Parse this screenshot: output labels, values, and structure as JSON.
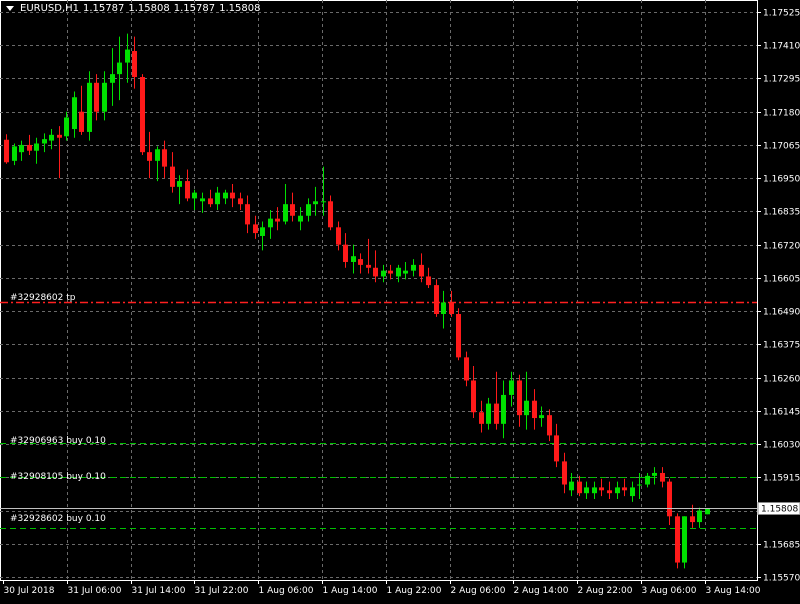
{
  "header": {
    "symbol": "EURUSD,H1",
    "open": "1.15787",
    "high": "1.15808",
    "low": "1.15787",
    "close": "1.15808"
  },
  "orders": [
    {
      "label": "#32906963 buy 0.10",
      "price": 1.16035,
      "color": "#00c000"
    },
    {
      "label": "#32908105 buy 0.10",
      "price": 1.15915,
      "color": "#00c000"
    },
    {
      "label": "#32928602 buy 0.10",
      "price": 1.1574,
      "color": "#00c000"
    }
  ],
  "tp_line": {
    "label": "#32928602 tp",
    "price": 1.1652,
    "color": "#ff2020"
  },
  "current_price": {
    "label": "1.15808",
    "price": 1.15808
  },
  "colors": {
    "bull": "#00e000",
    "bear": "#ff1a1a",
    "grid": "#6a6a6a",
    "background": "#000000"
  },
  "chart_data": {
    "type": "candlestick",
    "ylim": [
      1.1557,
      1.17525
    ],
    "y_ticks": [
      "1.17525",
      "1.17410",
      "1.17295",
      "1.17180",
      "1.17065",
      "1.16950",
      "1.16835",
      "1.16720",
      "1.16605",
      "1.16490",
      "1.16375",
      "1.16260",
      "1.16145",
      "1.16030",
      "1.15915",
      "1.15800",
      "1.15685",
      "1.15570"
    ],
    "x_ticks": [
      "30 Jul 2018",
      "31 Jul 06:00",
      "31 Jul 14:00",
      "31 Jul 22:00",
      "1 Aug 06:00",
      "1 Aug 14:00",
      "1 Aug 22:00",
      "2 Aug 06:00",
      "2 Aug 14:00",
      "2 Aug 22:00",
      "3 Aug 06:00",
      "3 Aug 14:00"
    ],
    "candles": [
      [
        1.17083,
        1.17102,
        1.17,
        1.17005
      ],
      [
        1.1701,
        1.1707,
        1.16995,
        1.1706
      ],
      [
        1.1704,
        1.1708,
        1.1701,
        1.17065
      ],
      [
        1.17065,
        1.171,
        1.1703,
        1.17045
      ],
      [
        1.17045,
        1.1709,
        1.17,
        1.1707
      ],
      [
        1.1707,
        1.17105,
        1.1704,
        1.17085
      ],
      [
        1.1708,
        1.1712,
        1.1705,
        1.171
      ],
      [
        1.171,
        1.1713,
        1.1695,
        1.1709
      ],
      [
        1.17095,
        1.1718,
        1.1708,
        1.1716
      ],
      [
        1.1712,
        1.1725,
        1.1709,
        1.1723
      ],
      [
        1.1718,
        1.1727,
        1.171,
        1.1711
      ],
      [
        1.1711,
        1.1732,
        1.1708,
        1.1728
      ],
      [
        1.1728,
        1.1731,
        1.1715,
        1.1718
      ],
      [
        1.1718,
        1.1732,
        1.1715,
        1.1728
      ],
      [
        1.1728,
        1.174,
        1.172,
        1.1731
      ],
      [
        1.1731,
        1.1744,
        1.1722,
        1.1735
      ],
      [
        1.1735,
        1.1745,
        1.1728,
        1.17395
      ],
      [
        1.1739,
        1.1744,
        1.1726,
        1.173
      ],
      [
        1.173,
        1.1731,
        1.1703,
        1.1704
      ],
      [
        1.1704,
        1.1711,
        1.1695,
        1.1701
      ],
      [
        1.1701,
        1.1706,
        1.1694,
        1.1705
      ],
      [
        1.1705,
        1.1708,
        1.1695,
        1.1699
      ],
      [
        1.1699,
        1.1704,
        1.169,
        1.1692
      ],
      [
        1.1692,
        1.1696,
        1.1686,
        1.1694
      ],
      [
        1.1694,
        1.1698,
        1.1687,
        1.1688
      ],
      [
        1.1688,
        1.1691,
        1.1684,
        1.169
      ],
      [
        1.1687,
        1.169,
        1.1683,
        1.1688
      ],
      [
        1.1688,
        1.1691,
        1.1685,
        1.1686
      ],
      [
        1.1686,
        1.1692,
        1.1684,
        1.169
      ],
      [
        1.1688,
        1.1691,
        1.1686,
        1.169
      ],
      [
        1.169,
        1.1693,
        1.1685,
        1.1688
      ],
      [
        1.1688,
        1.169,
        1.1684,
        1.1686
      ],
      [
        1.1686,
        1.1689,
        1.1676,
        1.1679
      ],
      [
        1.1679,
        1.1682,
        1.1674,
        1.1676
      ],
      [
        1.1675,
        1.168,
        1.167,
        1.1678
      ],
      [
        1.1678,
        1.1684,
        1.1674,
        1.1681
      ],
      [
        1.1681,
        1.1685,
        1.1677,
        1.168
      ],
      [
        1.168,
        1.1693,
        1.1679,
        1.1686
      ],
      [
        1.1686,
        1.169,
        1.168,
        1.1682
      ],
      [
        1.168,
        1.1685,
        1.1677,
        1.1682
      ],
      [
        1.1682,
        1.1688,
        1.168,
        1.1686
      ],
      [
        1.1686,
        1.1692,
        1.1682,
        1.1687
      ],
      [
        1.1687,
        1.1699,
        1.1682,
        1.1687
      ],
      [
        1.1687,
        1.1689,
        1.1677,
        1.1678
      ],
      [
        1.1678,
        1.168,
        1.167,
        1.1672
      ],
      [
        1.1672,
        1.1676,
        1.1664,
        1.1666
      ],
      [
        1.1666,
        1.1672,
        1.1662,
        1.1668
      ],
      [
        1.1667,
        1.1669,
        1.1662,
        1.1665
      ],
      [
        1.1665,
        1.1674,
        1.1662,
        1.1664
      ],
      [
        1.1664,
        1.167,
        1.1659,
        1.1661
      ],
      [
        1.1661,
        1.1665,
        1.1659,
        1.1663
      ],
      [
        1.1663,
        1.1665,
        1.166,
        1.1662
      ],
      [
        1.1661,
        1.1665,
        1.1659,
        1.1664
      ],
      [
        1.1662,
        1.1666,
        1.166,
        1.1663
      ],
      [
        1.1663,
        1.1667,
        1.1661,
        1.1665
      ],
      [
        1.1665,
        1.1669,
        1.1659,
        1.1661
      ],
      [
        1.1661,
        1.1664,
        1.1657,
        1.1658
      ],
      [
        1.1658,
        1.166,
        1.1647,
        1.1648
      ],
      [
        1.1648,
        1.1656,
        1.1643,
        1.1652
      ],
      [
        1.1652,
        1.1656,
        1.1647,
        1.1648
      ],
      [
        1.1648,
        1.165,
        1.1632,
        1.1633
      ],
      [
        1.1633,
        1.1635,
        1.1623,
        1.1625
      ],
      [
        1.1625,
        1.163,
        1.1612,
        1.1614
      ],
      [
        1.1614,
        1.1618,
        1.1607,
        1.161
      ],
      [
        1.161,
        1.1619,
        1.1608,
        1.1617
      ],
      [
        1.1617,
        1.1628,
        1.1608,
        1.161
      ],
      [
        1.161,
        1.1625,
        1.1605,
        1.162
      ],
      [
        1.162,
        1.1628,
        1.1616,
        1.1625
      ],
      [
        1.1625,
        1.1627,
        1.1609,
        1.1613
      ],
      [
        1.1613,
        1.1628,
        1.1608,
        1.1618
      ],
      [
        1.1618,
        1.1622,
        1.1608,
        1.1612
      ],
      [
        1.1612,
        1.1616,
        1.1609,
        1.1613
      ],
      [
        1.1613,
        1.1615,
        1.1604,
        1.1606
      ],
      [
        1.1606,
        1.161,
        1.1595,
        1.1597
      ],
      [
        1.1597,
        1.16,
        1.1586,
        1.1589
      ],
      [
        1.1587,
        1.1593,
        1.1585,
        1.159
      ],
      [
        1.159,
        1.1592,
        1.1585,
        1.1586
      ],
      [
        1.1586,
        1.159,
        1.1584,
        1.1588
      ],
      [
        1.1586,
        1.159,
        1.1584,
        1.1588
      ],
      [
        1.1588,
        1.1591,
        1.1585,
        1.1587
      ],
      [
        1.1587,
        1.159,
        1.1584,
        1.1586
      ],
      [
        1.1586,
        1.159,
        1.1584,
        1.1588
      ],
      [
        1.1588,
        1.1591,
        1.1585,
        1.1587
      ],
      [
        1.1585,
        1.159,
        1.1583,
        1.1588
      ],
      [
        1.1589,
        1.1593,
        1.1584,
        1.1589
      ],
      [
        1.1589,
        1.1593,
        1.1588,
        1.1592
      ],
      [
        1.1592,
        1.1595,
        1.1589,
        1.1593
      ],
      [
        1.1593,
        1.1595,
        1.1588,
        1.159
      ],
      [
        1.159,
        1.1591,
        1.1575,
        1.1578
      ],
      [
        1.1578,
        1.1579,
        1.156,
        1.1562
      ],
      [
        1.1562,
        1.1578,
        1.156,
        1.1578
      ],
      [
        1.1578,
        1.1582,
        1.1574,
        1.1576
      ],
      [
        1.1576,
        1.1581,
        1.1574,
        1.158
      ],
      [
        1.15787,
        1.15808,
        1.15787,
        1.15808
      ]
    ]
  }
}
